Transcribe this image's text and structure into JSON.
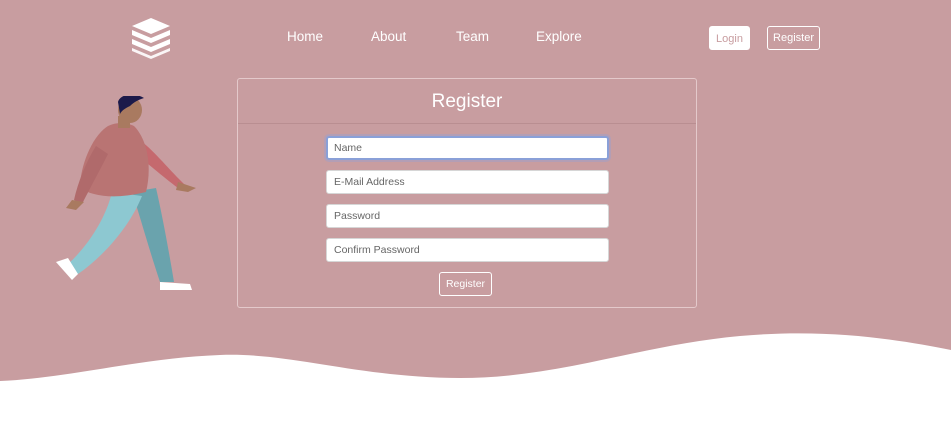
{
  "colors": {
    "hero_background": "#c89da0",
    "page_background": "#ffffff",
    "text_light": "#ffffff",
    "focus_ring": "#8aa0d8"
  },
  "logo": {
    "icon": "stack-layers-icon"
  },
  "nav": {
    "links": [
      {
        "label": "Home"
      },
      {
        "label": "About"
      },
      {
        "label": "Team"
      },
      {
        "label": "Explore"
      }
    ],
    "login_label": "Login",
    "register_label": "Register"
  },
  "illustration": {
    "icon": "walking-person-illustration"
  },
  "register_card": {
    "title": "Register",
    "fields": {
      "name": {
        "placeholder": "Name",
        "value": ""
      },
      "email": {
        "placeholder": "E-Mail Address",
        "value": ""
      },
      "password": {
        "placeholder": "Password",
        "value": ""
      },
      "confirm_password": {
        "placeholder": "Confirm Password",
        "value": ""
      }
    },
    "submit_label": "Register"
  }
}
